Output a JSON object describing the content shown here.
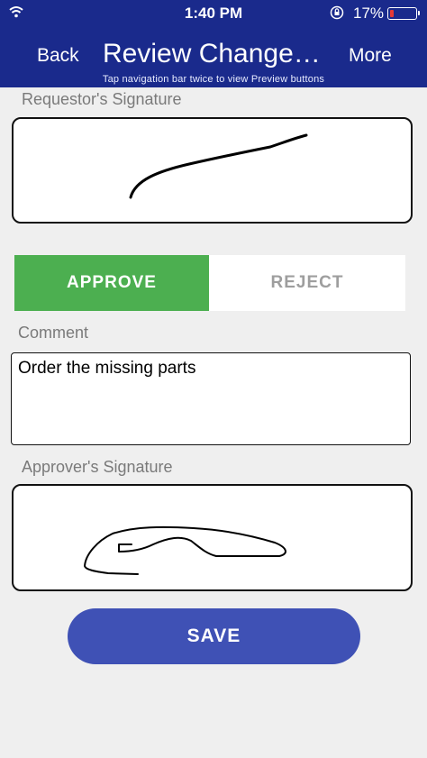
{
  "status_bar": {
    "time": "1:40 PM",
    "battery_percent": "17%",
    "battery_level": 0.17,
    "icons": [
      "wifi-icon",
      "rotation-lock-icon",
      "battery-icon"
    ]
  },
  "nav": {
    "back_label": "Back",
    "title": "Review Change…",
    "more_label": "More",
    "hint": "Tap navigation bar twice to view Preview buttons"
  },
  "requestor": {
    "label": "Requestor's Signature"
  },
  "decision": {
    "approve_label": "APPROVE",
    "reject_label": "REJECT",
    "selected": "APPROVE"
  },
  "comment": {
    "label": "Comment",
    "value": "Order the missing parts"
  },
  "approver": {
    "label": "Approver's Signature"
  },
  "save_label": "SAVE",
  "colors": {
    "nav_bar": "#1a2a8c",
    "approve_selected": "#4caf50",
    "save_button": "#3f51b5",
    "background": "#efefef"
  }
}
